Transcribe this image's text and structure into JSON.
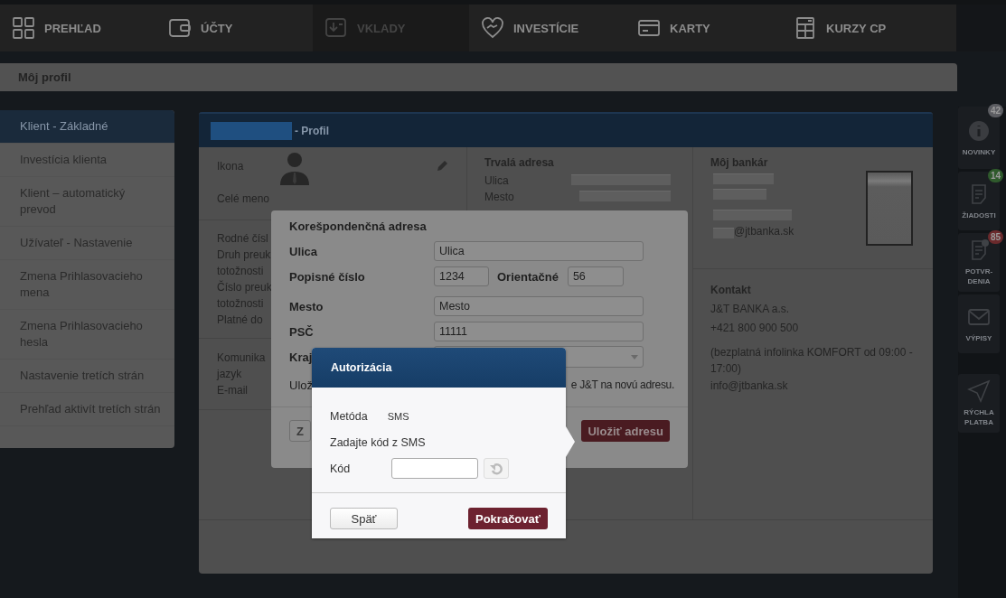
{
  "nav": [
    {
      "label": "PREHĽAD",
      "disabled": false
    },
    {
      "label": "ÚČTY",
      "disabled": false
    },
    {
      "label": "VKLADY",
      "disabled": true
    },
    {
      "label": "INVESTÍCIE",
      "disabled": false
    },
    {
      "label": "KARTY",
      "disabled": false
    },
    {
      "label": "KURZY CP",
      "disabled": false
    }
  ],
  "page_title": "Môj profil",
  "sidebar": {
    "items": [
      {
        "label": "Klient - Základné",
        "selected": true
      },
      {
        "label": "Investícia klienta",
        "selected": false
      },
      {
        "label": "Klient – automatický prevod",
        "selected": false
      },
      {
        "label": "Užívateľ - Nastavenie",
        "selected": false
      },
      {
        "label": "Zmena Prihlasovacieho mena",
        "selected": false
      },
      {
        "label": "Zmena Prihlasovacieho hesla",
        "selected": false
      },
      {
        "label": "Nastavenie tretích strán",
        "selected": false
      },
      {
        "label": "Prehľad aktivít tretích strán",
        "selected": false
      }
    ]
  },
  "profile": {
    "title": "- Profil",
    "icon_label": "Ikona",
    "name_label": "Celé meno",
    "id_labels": [
      "Rodné čísl",
      "Druh preuk",
      "totožnosti",
      "Číslo preuk",
      "totožnosti",
      "Platné do"
    ],
    "contact_labels": [
      "Komunika",
      "jazyk",
      "E-mail"
    ],
    "permanent_address": {
      "heading": "Trvalá adresa",
      "labels": [
        "Ulica",
        "Mesto"
      ]
    },
    "banker": {
      "heading": "Môj bankár",
      "email": "@jtbanka.sk"
    },
    "contact": {
      "heading": "Kontakt",
      "lines": [
        "J&T BANKA a.s.",
        "+421 800 900 500",
        "(bezplatná infolinka KOMFORT od 09:00 - 17:00)",
        "info@jtbanka.sk"
      ]
    }
  },
  "rail": [
    {
      "label": "NOVINKY",
      "badge": "42",
      "color": "#5c5d62"
    },
    {
      "label": "ŽIADOSTI",
      "badge": "14",
      "color": "#2f5a2c"
    },
    {
      "label": "POTVR-DENIA",
      "badge": "85",
      "color": "#6a2a2c"
    },
    {
      "label": "VÝPISY"
    },
    {
      "label": "RÝCHLA PLATBA"
    }
  ],
  "address_dialog": {
    "title": "Korešpondenčná adresa",
    "fields": [
      {
        "kind": "text",
        "label": "Ulica",
        "value": "Ulica"
      },
      {
        "kind": "pair",
        "label": "Popisné číslo",
        "value": "1234",
        "second_label": "Orientačné",
        "second_value": "56"
      },
      {
        "kind": "text",
        "label": "Mesto",
        "value": "Mesto"
      },
      {
        "kind": "text",
        "label": "PSČ",
        "value": "11111"
      },
      {
        "kind": "select",
        "label": "Kraj"
      }
    ],
    "note_start": "Ulož",
    "note_end": "e J&T na novú adresu.",
    "back_button": "Z",
    "save_button": "Uložiť adresu"
  },
  "auth": {
    "title": "Autorizácia",
    "method_label": "Metóda",
    "method_value": "SMS",
    "instruction": "Zadajte kód z SMS",
    "code_label": "Kód",
    "back_button": "Späť",
    "continue_button": "Pokračovať"
  }
}
